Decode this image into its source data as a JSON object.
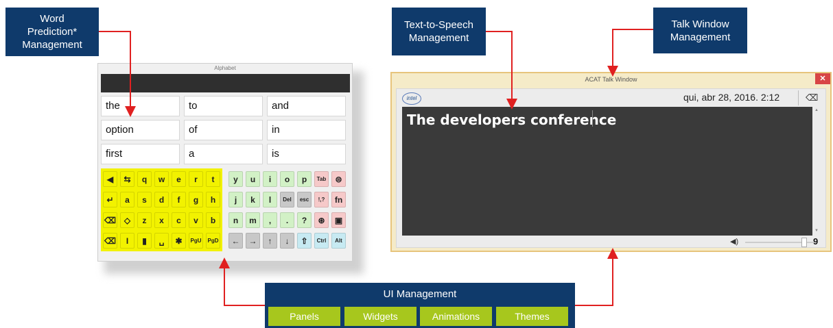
{
  "callouts": {
    "word_prediction": "Word\nPrediction*\nManagement",
    "tts": "Text-to-Speech\nManagement",
    "talk_window": "Talk Window\nManagement",
    "ui": "UI Management"
  },
  "ui_tabs": [
    "Panels",
    "Widgets",
    "Animations",
    "Themes"
  ],
  "keyboard": {
    "title": "Alphabet",
    "words": [
      [
        "the",
        "to",
        "and"
      ],
      [
        "option",
        "of",
        "in"
      ],
      [
        "first",
        "a",
        "is"
      ]
    ],
    "yellow_rows": [
      [
        "◀",
        "⇆",
        "q",
        "w",
        "e",
        "r",
        "t"
      ],
      [
        "↵",
        "a",
        "s",
        "d",
        "f",
        "g",
        "h"
      ],
      [
        "⌫",
        "◇",
        "z",
        "x",
        "c",
        "v",
        "b"
      ],
      [
        "⌫",
        "I",
        "▮",
        "␣",
        "✱",
        "PgU",
        "PgD"
      ]
    ],
    "right_rows": [
      [
        "y",
        "u",
        "i",
        "o",
        "p",
        "Tab",
        "⊜"
      ],
      [
        "j",
        "k",
        "l",
        "Del",
        "esc",
        "!,?",
        "fn"
      ],
      [
        "n",
        "m",
        ",",
        ".",
        "?",
        "⊛",
        "▣"
      ],
      [
        "←",
        "→",
        "↑",
        "↓",
        "⇧",
        "Ctrl",
        "Alt"
      ]
    ],
    "colors": {
      "yellow": "#f2f200",
      "green": "#d2f1c6",
      "pink": "#f6c9c9",
      "gray": "#c8c8c8",
      "cyan": "#c7eaf2"
    }
  },
  "talk": {
    "title": "ACAT Talk Window",
    "close": "✕",
    "logo": "intel",
    "datetime": "qui, abr 28, 2016. 2:12",
    "eraser": "⌫",
    "text": "The developers conference",
    "volume_icon": "◀)",
    "volume_value": "9"
  }
}
